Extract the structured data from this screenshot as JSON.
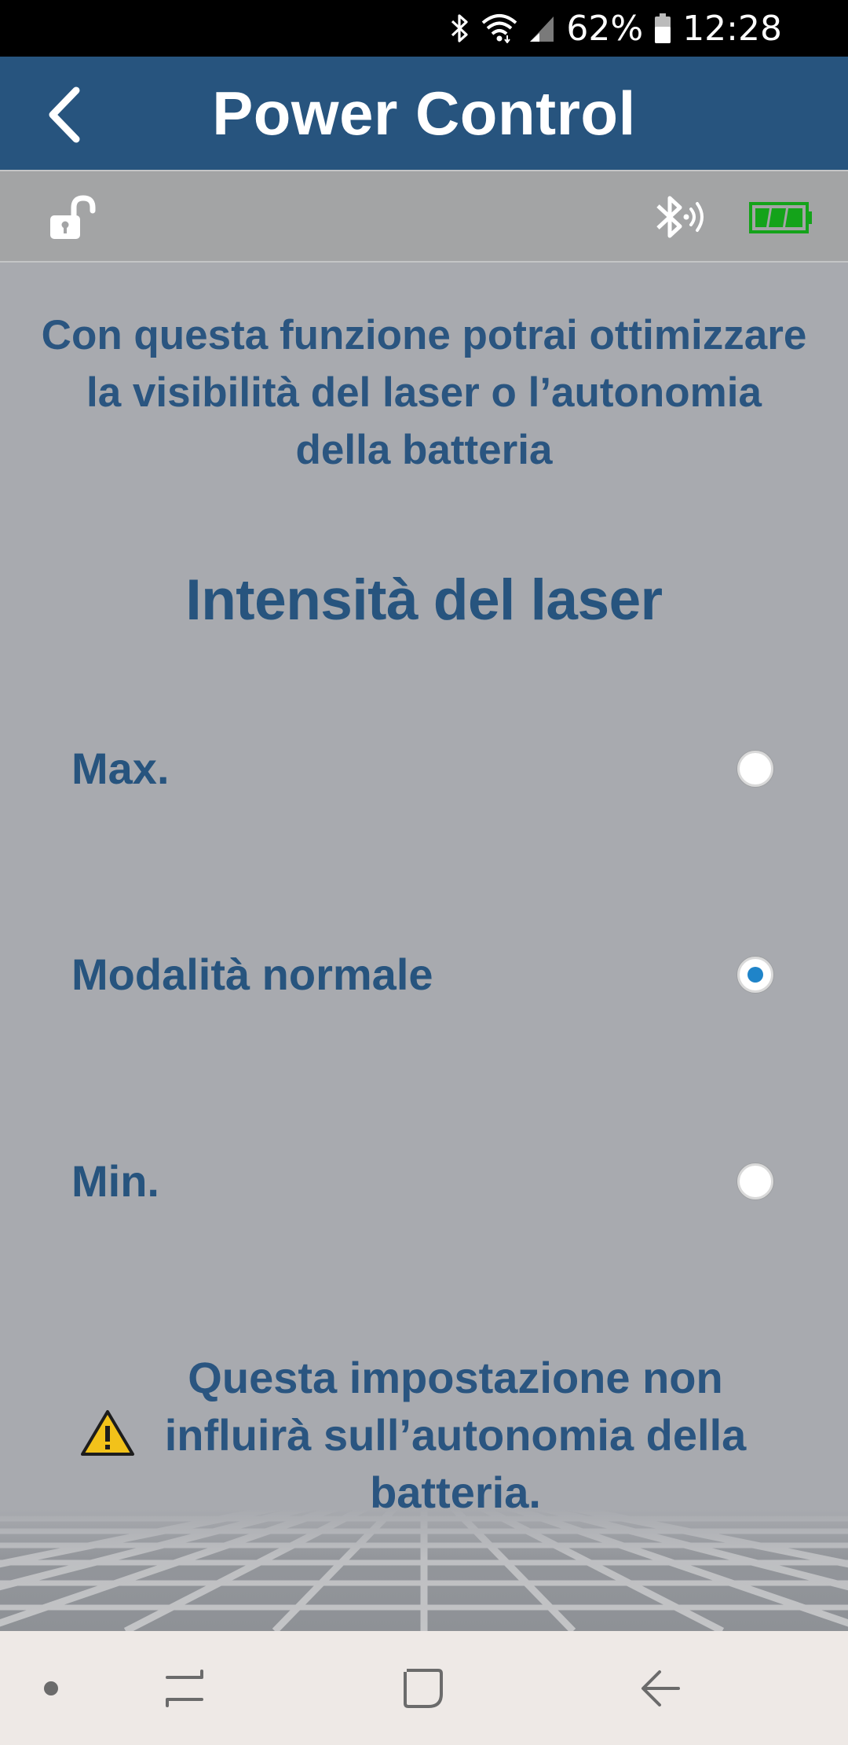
{
  "status_bar": {
    "battery_percent": "62%",
    "time": "12:28",
    "icons": [
      "bluetooth-icon",
      "wifi-icon",
      "cell-signal-icon",
      "battery-icon"
    ]
  },
  "header": {
    "title": "Power Control",
    "back_icon": "chevron-left-icon"
  },
  "device_bar": {
    "lock_icon": "unlocked-padlock-icon",
    "connection_icon": "bluetooth-connected-icon",
    "battery_icon": "device-battery-full-icon",
    "battery_color": "#14a31a"
  },
  "content": {
    "intro": "Con questa funzione potrai ottimizzare la visibilità del laser o l’autonomia della batteria",
    "section_title": "Intensità del laser",
    "options": [
      {
        "label": "Max.",
        "selected": false
      },
      {
        "label": "Modalità normale",
        "selected": true
      },
      {
        "label": "Min.",
        "selected": false
      }
    ],
    "note": "Questa impostazione non influirà sull’autonomia della batteria.",
    "note_icon": "warning-icon"
  },
  "nav_bar": {
    "items": [
      "dot-icon",
      "recent-apps-icon",
      "home-icon",
      "back-arrow-icon"
    ]
  },
  "colors": {
    "header_bg": "#27547e",
    "text_blue": "#27547e",
    "page_bg": "#a8aaaf",
    "radio_selected": "#1f84c9",
    "nav_bg": "#eee9e6"
  }
}
